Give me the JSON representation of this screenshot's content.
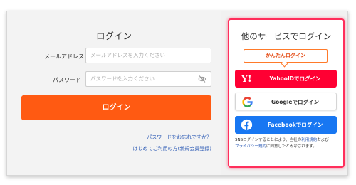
{
  "login": {
    "title": "ログイン",
    "email_label": "メールアドレス",
    "email_placeholder": "メールアドレスを入力ください",
    "password_label": "パスワード",
    "password_placeholder": "パスワードを入力ください",
    "login_button": "ログイン",
    "forgot_link": "パスワードをお忘れですか？",
    "register_link": "はじめてご利用の方(新規会員登録)"
  },
  "social": {
    "title": "他のサービスでログイン",
    "quick_label": "かんたんログイン",
    "yahoo_label": "YahooIDでログイン",
    "google_label": "Googleでログイン",
    "facebook_label": "Facebookでログイン",
    "note_prefix": "SNSログインすることにより、当社の",
    "terms_link": "利用規約",
    "note_and": "および",
    "privacy_link": "プライバシー規約",
    "note_suffix": "に同意したとみなされます。"
  },
  "colors": {
    "login_button": "#ff5a12",
    "yahoo": "#ff0033",
    "facebook": "#1877f2",
    "highlight_border": "#ff2e5b",
    "link": "#2d5bb5"
  },
  "icons": {
    "password_toggle": "eye-slash-icon",
    "yahoo": "yahoo-logo-icon",
    "google": "google-logo-icon",
    "facebook": "facebook-logo-icon"
  }
}
